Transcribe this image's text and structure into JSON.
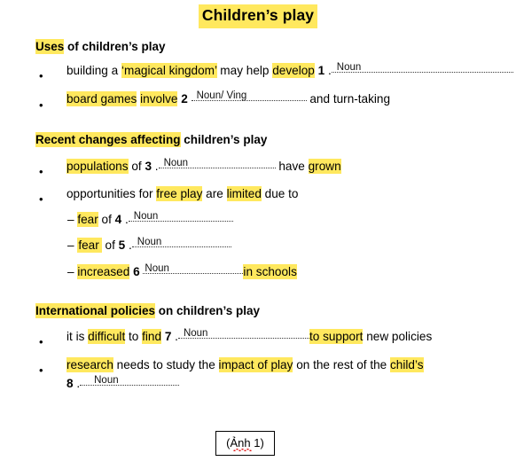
{
  "document": {
    "title": "Children’s play",
    "caption": "(Ảnh 1)"
  },
  "sections": [
    {
      "heading_highlighted": "Uses",
      "heading_rest": " of children’s play",
      "bullets": [
        {
          "marker": "•",
          "pre": "building a ",
          "quoted_highlight": "‘magical kingdom’",
          "mid": " may help ",
          "verb_highlight": "develop",
          "number": "1",
          "answer": "Noun",
          "post": ""
        },
        {
          "marker": "•",
          "highlight_a": "board games",
          "highlight_b": "involve",
          "number": "2",
          "answer": "Noun/ Ving",
          "post": "and turn-taking"
        }
      ]
    },
    {
      "heading_highlighted": "Recent changes affecting",
      "heading_rest": " children’s play",
      "bullets": [
        {
          "marker": "•",
          "highlight_a": "populations",
          "mid": " of ",
          "number": "3",
          "answer": "Noun",
          "post_plain": "have ",
          "post_highlight": "grown"
        },
        {
          "marker": "•",
          "pre": "opportunities for ",
          "highlight_a": "free play",
          "mid": " are ",
          "highlight_b": "limited",
          "post": " due to"
        }
      ],
      "sub_bullets": [
        {
          "marker": "–",
          "highlight_a": "fear",
          "mid": " of ",
          "number": "4",
          "answer": "Noun",
          "post": ""
        },
        {
          "marker": "–",
          "highlight_a": "fear",
          "mid": " of ",
          "number": "5",
          "answer": "Noun",
          "post": ""
        },
        {
          "marker": "–",
          "highlight_a": "increased",
          "mid": " ",
          "number": "6",
          "answer": "Noun",
          "post_highlight": "in schools"
        }
      ]
    },
    {
      "heading_highlighted": "International policies",
      "heading_rest": " on children’s play",
      "bullets": [
        {
          "marker": "•",
          "pre": "it is ",
          "highlight_a": "difficult",
          "mid": " to ",
          "highlight_b": "find",
          "number": "7",
          "answer": "Noun",
          "post_highlight": "to support",
          "post_plain": " new policies"
        },
        {
          "marker": "•",
          "highlight_a": "research",
          "mid": " needs to study the ",
          "highlight_b": "impact of play",
          "mid2": " on the rest of the ",
          "highlight_c": "child’s",
          "number": "8",
          "answer": "Noun"
        }
      ]
    }
  ],
  "colors": {
    "highlight": "#ffe85e",
    "text": "#000000",
    "spellcheck_underline": "#e01b1b"
  }
}
